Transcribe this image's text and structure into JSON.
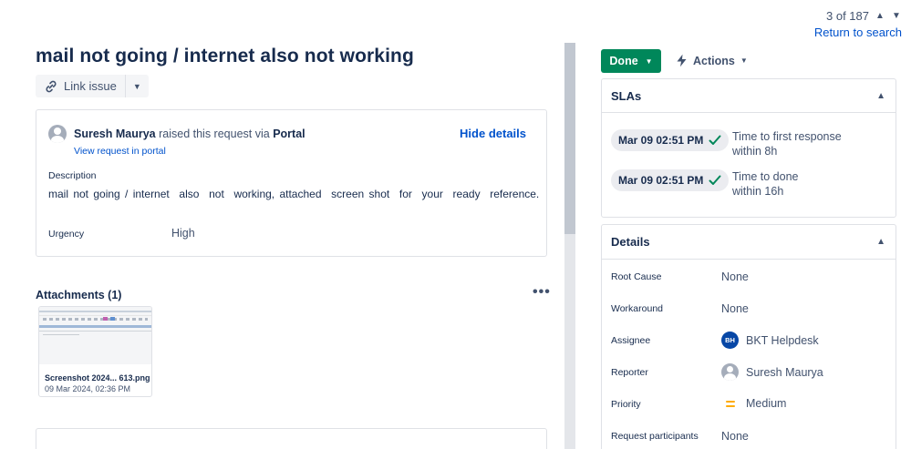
{
  "pager": {
    "position": "3 of 187",
    "return_label": "Return to search"
  },
  "issue": {
    "title": "mail not going / internet also not working"
  },
  "toolbar": {
    "link_issue_label": "Link issue"
  },
  "request": {
    "requester": "Suresh Maurya",
    "raised_text": "raised this request via",
    "channel": "Portal",
    "view_link": "View request in portal",
    "hide_details": "Hide details",
    "description_label": "Description",
    "description": "mail not going / internet  also  not  working, attached  screen shot  for  your  ready  reference.",
    "urgency_label": "Urgency",
    "urgency": "High"
  },
  "attachments": {
    "title": "Attachments (1)",
    "more": "•••",
    "items": [
      {
        "name": "Screenshot 2024... 613.png",
        "date": "09 Mar 2024, 02:36 PM"
      }
    ]
  },
  "status": {
    "label": "Done",
    "actions_label": "Actions"
  },
  "slas": {
    "title": "SLAs",
    "items": [
      {
        "time": "Mar 09 02:51 PM",
        "name": "Time to first response",
        "target": "within 8h"
      },
      {
        "time": "Mar 09 02:51 PM",
        "name": "Time to done",
        "target": "within 16h"
      }
    ]
  },
  "details": {
    "title": "Details",
    "root_cause_label": "Root Cause",
    "root_cause": "None",
    "workaround_label": "Workaround",
    "workaround": "None",
    "assignee_label": "Assignee",
    "assignee_initials": "BH",
    "assignee": "BKT Helpdesk",
    "reporter_label": "Reporter",
    "reporter": "Suresh Maurya",
    "priority_label": "Priority",
    "priority": "Medium",
    "participants_label": "Request participants",
    "participants": "None"
  },
  "colors": {
    "done_green": "#00875a",
    "link_blue": "#0052cc",
    "priority_medium": "#ffab00",
    "assignee_avatar": "#0747a6"
  }
}
